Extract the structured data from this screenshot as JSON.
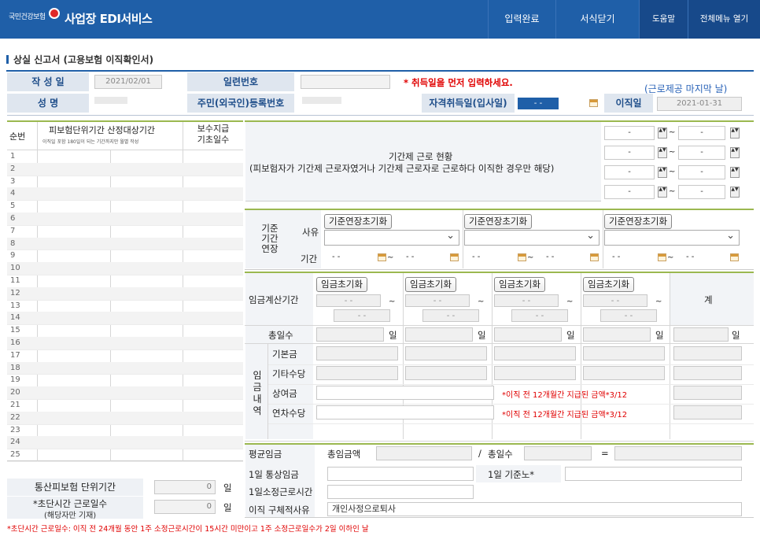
{
  "topbar": {
    "logo": "국민건강보험",
    "title": "사업장 EDI서비스",
    "buttons": [
      "입력완료",
      "서식닫기",
      "도움말",
      "전체메뉴 열기"
    ]
  },
  "page": {
    "title": "상실 신고서 (고용보험 이직확인서)"
  },
  "header": {
    "write_date_label": "작 성 일",
    "write_date": "2021/02/01",
    "serial_label": "일련번호",
    "notice": "* 취득일을 먼저 입력하세요.",
    "last_day_note": "(근로제공 마지막 날)",
    "name_label": "성 명",
    "rrn_label": "주민(외국인)등록번호",
    "acq_label": "자격취득일(입사일)",
    "acq_value": "- -",
    "leave_label": "이직일",
    "leave_value": "2021-01-31"
  },
  "left_table": {
    "col_no": "순번",
    "col_period": "피보험단위기간 산정대상기간",
    "col_period_sub": "이직일 포함 180일이 되는 기간까지만 월별 작성",
    "col_days": "보수지급 기초일수",
    "rows": [
      "1",
      "2",
      "3",
      "4",
      "5",
      "6",
      "7",
      "8",
      "9",
      "10",
      "11",
      "12",
      "13",
      "14",
      "15",
      "16",
      "17",
      "18",
      "19",
      "20",
      "21",
      "22",
      "23",
      "24",
      "25"
    ],
    "total_label": "통산피보험 단위기간",
    "total_value": "0",
    "total_unit": "일",
    "short_label": "*초단시간 근로일수",
    "short_sub": "(해당자만 기재)",
    "short_value": "0",
    "short_unit": "일",
    "footnote": "*초단시간 근로일수: 이직 전 24개월 동안 1주 소정근로시간이 15시간 미만이고 1주 소정근로일수가 2일 이하인 날"
  },
  "term": {
    "title": "기간제 근로 현황",
    "desc": "(피보험자가 기간제 근로자였거나 기간제 근로자로 근로하다 이직한 경우만 해당)",
    "dash": "-",
    "tilde": "~"
  },
  "ext": {
    "label": "기준 기간 연장",
    "reason_label": "사유",
    "period_label": "기간",
    "reset_btn": "기준연장초기화",
    "date": "- -",
    "tilde": "~"
  },
  "wage": {
    "period_label": "임금계산기간",
    "reset_btn": "임금초기화",
    "date": "- -",
    "tilde": "~",
    "total_col": "계",
    "days_label": "총일수",
    "day_unit": "일",
    "group_label": "임금내역",
    "items": [
      "기본금",
      "기타수당",
      "상여금",
      "연차수당"
    ],
    "note": "*이직 전 12개월간 지급된 금액*3/12"
  },
  "avg": {
    "avg_label": "평균임금",
    "total_amt_label": "총임금액",
    "slash": "/",
    "total_days_label": "총일수",
    "equals": "=",
    "daily_label": "1일 통상임금",
    "daily_std_label": "1일 기준노*",
    "hours_label": "1일소정근로시간",
    "reason_label": "이직 구체적사유",
    "reason_value": "개인사정으로퇴사"
  }
}
